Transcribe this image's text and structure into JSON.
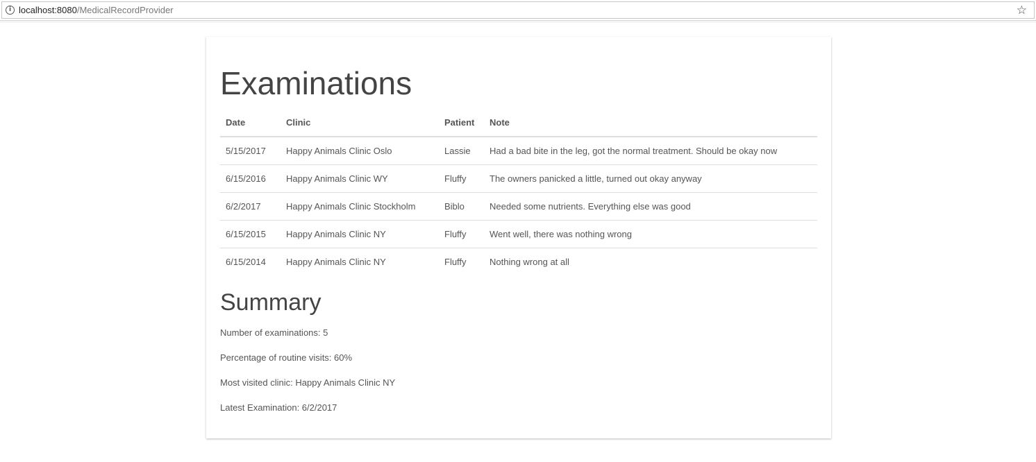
{
  "browser": {
    "url_host": "localhost:8080",
    "url_path": "/MedicalRecordProvider",
    "info_icon": "info-icon",
    "star_icon": "star-icon"
  },
  "page": {
    "title": "Examinations"
  },
  "table": {
    "headers": [
      "Date",
      "Clinic",
      "Patient",
      "Note"
    ],
    "rows": [
      {
        "date": "5/15/2017",
        "clinic": "Happy Animals Clinic Oslo",
        "patient": "Lassie",
        "note": "Had a bad bite in the leg, got the normal treatment. Should be okay now"
      },
      {
        "date": "6/15/2016",
        "clinic": "Happy Animals Clinic WY",
        "patient": "Fluffy",
        "note": "The owners panicked a little, turned out okay anyway"
      },
      {
        "date": "6/2/2017",
        "clinic": "Happy Animals Clinic Stockholm",
        "patient": "Biblo",
        "note": "Needed some nutrients. Everything else was good"
      },
      {
        "date": "6/15/2015",
        "clinic": "Happy Animals Clinic NY",
        "patient": "Fluffy",
        "note": "Went well, there was nothing wrong"
      },
      {
        "date": "6/15/2014",
        "clinic": "Happy Animals Clinic NY",
        "patient": "Fluffy",
        "note": "Nothing wrong at all"
      }
    ]
  },
  "summary": {
    "title": "Summary",
    "lines": [
      "Number of examinations: 5",
      "Percentage of routine visits: 60%",
      "Most visited clinic: Happy Animals Clinic NY",
      "Latest Examination: 6/2/2017"
    ]
  }
}
